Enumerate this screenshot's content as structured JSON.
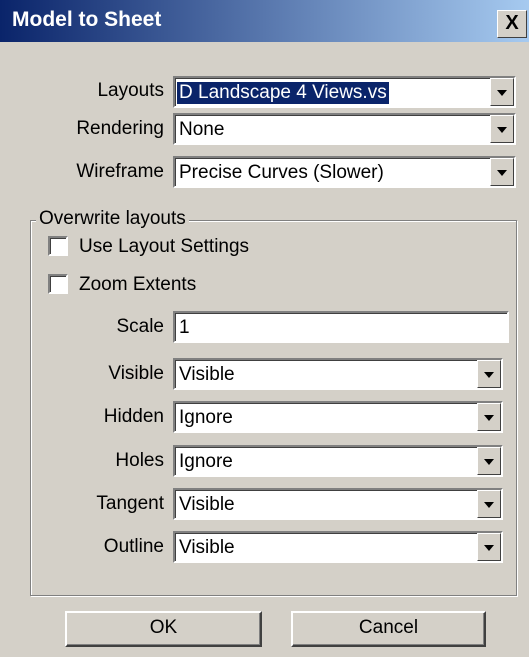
{
  "window": {
    "title": "Model to Sheet",
    "close": "X"
  },
  "layouts": {
    "label": "Layouts",
    "value": "D Landscape 4 Views.vs"
  },
  "rendering": {
    "label": "Rendering",
    "value": "None"
  },
  "wireframe": {
    "label": "Wireframe",
    "value": "Precise Curves (Slower)"
  },
  "overwrite": {
    "legend": "Overwrite layouts",
    "use_layout_settings": "Use Layout Settings",
    "zoom_extents": "Zoom Extents",
    "scale": {
      "label": "Scale",
      "value": "1"
    },
    "visible": {
      "label": "Visible",
      "value": "Visible"
    },
    "hidden": {
      "label": "Hidden",
      "value": "Ignore"
    },
    "holes": {
      "label": "Holes",
      "value": "Ignore"
    },
    "tangent": {
      "label": "Tangent",
      "value": "Visible"
    },
    "outline": {
      "label": "Outline",
      "value": "Visible"
    }
  },
  "buttons": {
    "ok": "OK",
    "cancel": "Cancel"
  }
}
